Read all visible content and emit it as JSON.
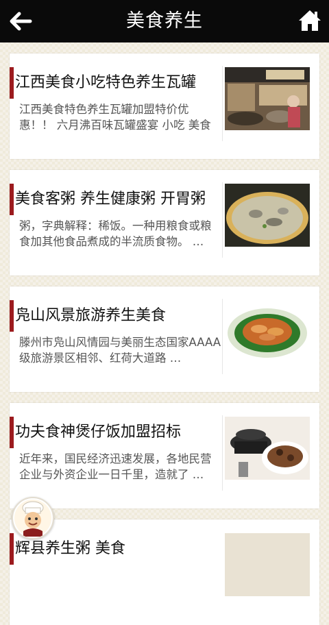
{
  "header": {
    "title": "美食养生",
    "back_icon": "arrow-left-icon",
    "home_icon": "home-icon"
  },
  "articles": [
    {
      "title": "江西美食小吃特色养生瓦罐",
      "desc": "江西美食特色养生瓦罐加盟特价优惠！！ 六月沸百味瓦罐盛宴 小吃 美食 …",
      "image": "restaurant-photo"
    },
    {
      "title": "美食客粥 养生健康粥 开胃粥",
      "desc": "粥，字典解释：稀饭。一种用粮食或粮食加其他食品煮成的半流质食物。 …",
      "image": "porridge-photo"
    },
    {
      "title": "凫山风景旅游养生美食",
      "desc": "滕州市凫山风情园与美丽生态国家AAAA级旅游景区相邻、红荷大道路 …",
      "image": "shrimp-dish-photo"
    },
    {
      "title": "功夫食神煲仔饭加盟招标",
      "desc": "近年来，国民经济迅速发展，各地民营企业与外资企业一日千里，造就了 …",
      "image": "claypot-rice-photo"
    },
    {
      "title": "辉县养生粥 美食",
      "desc": "",
      "image": "porridge-photo-2"
    }
  ],
  "floating": {
    "icon": "chef-avatar-icon"
  },
  "colors": {
    "topbar": "#0a0a0a",
    "accent": "#9c1b1e",
    "background": "#efeadb"
  }
}
